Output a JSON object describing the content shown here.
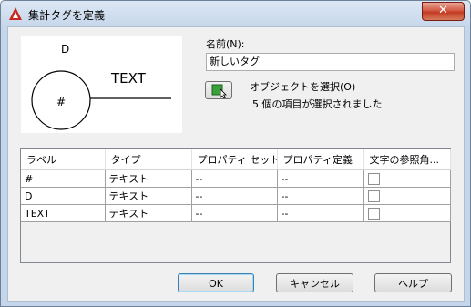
{
  "window": {
    "title": "集計タグを定義",
    "close_glyph": "✕"
  },
  "preview": {
    "tag_D": "D",
    "tag_hash": "#",
    "tag_TEXT": "TEXT"
  },
  "name_field": {
    "label": "名前(N):",
    "value": "新しいタグ"
  },
  "select_objects": {
    "label": "オブジェクトを選択(O)",
    "status": "5 個の項目が選択されました"
  },
  "table": {
    "columns": [
      "ラベル",
      "タイプ",
      "プロパティ セット",
      "プロパティ定義",
      "文字の参照角..."
    ],
    "rows": [
      {
        "label": "#",
        "type": "テキスト",
        "property_set": "--",
        "property_def": "--",
        "text_ref_angle": false
      },
      {
        "label": "D",
        "type": "テキスト",
        "property_set": "--",
        "property_def": "--",
        "text_ref_angle": false
      },
      {
        "label": "TEXT",
        "type": "テキスト",
        "property_set": "--",
        "property_def": "--",
        "text_ref_angle": false
      }
    ]
  },
  "buttons": {
    "ok": "OK",
    "cancel": "キャンセル",
    "help": "ヘルプ"
  },
  "colors": {
    "accent_red": "#c8271e",
    "select_icon_green": "#3aa03a"
  }
}
